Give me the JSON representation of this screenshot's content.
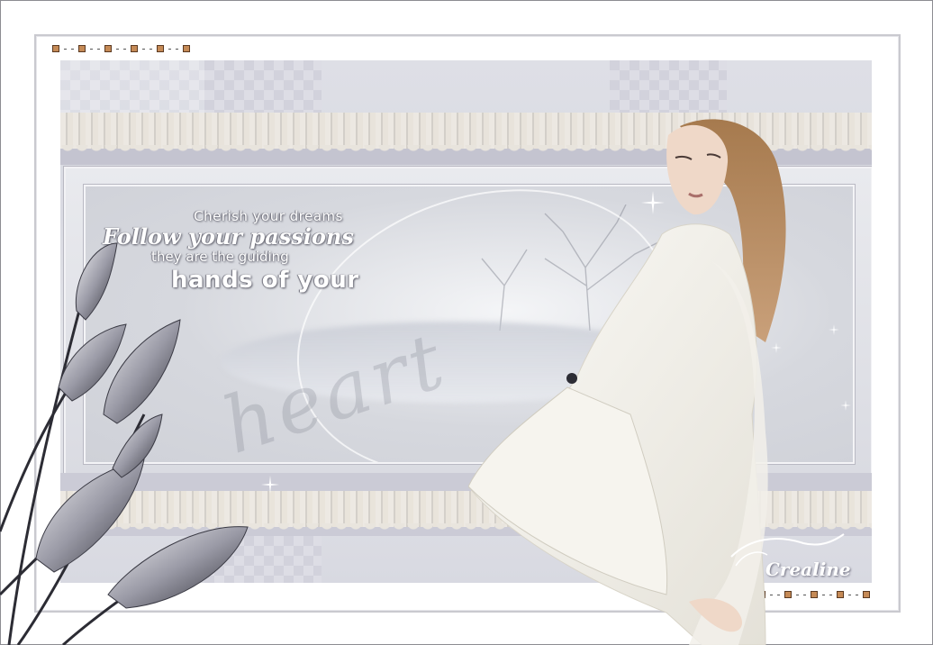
{
  "quote": {
    "line1": "Cherish your dreams",
    "line2": "Follow your passions",
    "line3": "they are the guiding",
    "line4": "hands of your",
    "script_word": "heart"
  },
  "signature": {
    "text": "Crealine"
  },
  "colors": {
    "frame": "#c9c9cf",
    "canvas": "#dedfe6",
    "dot": "#c58a56",
    "text_glow": "#ffffff"
  },
  "icons": [
    "sparkle-icon",
    "flower-icon",
    "corner-dot-icon"
  ]
}
